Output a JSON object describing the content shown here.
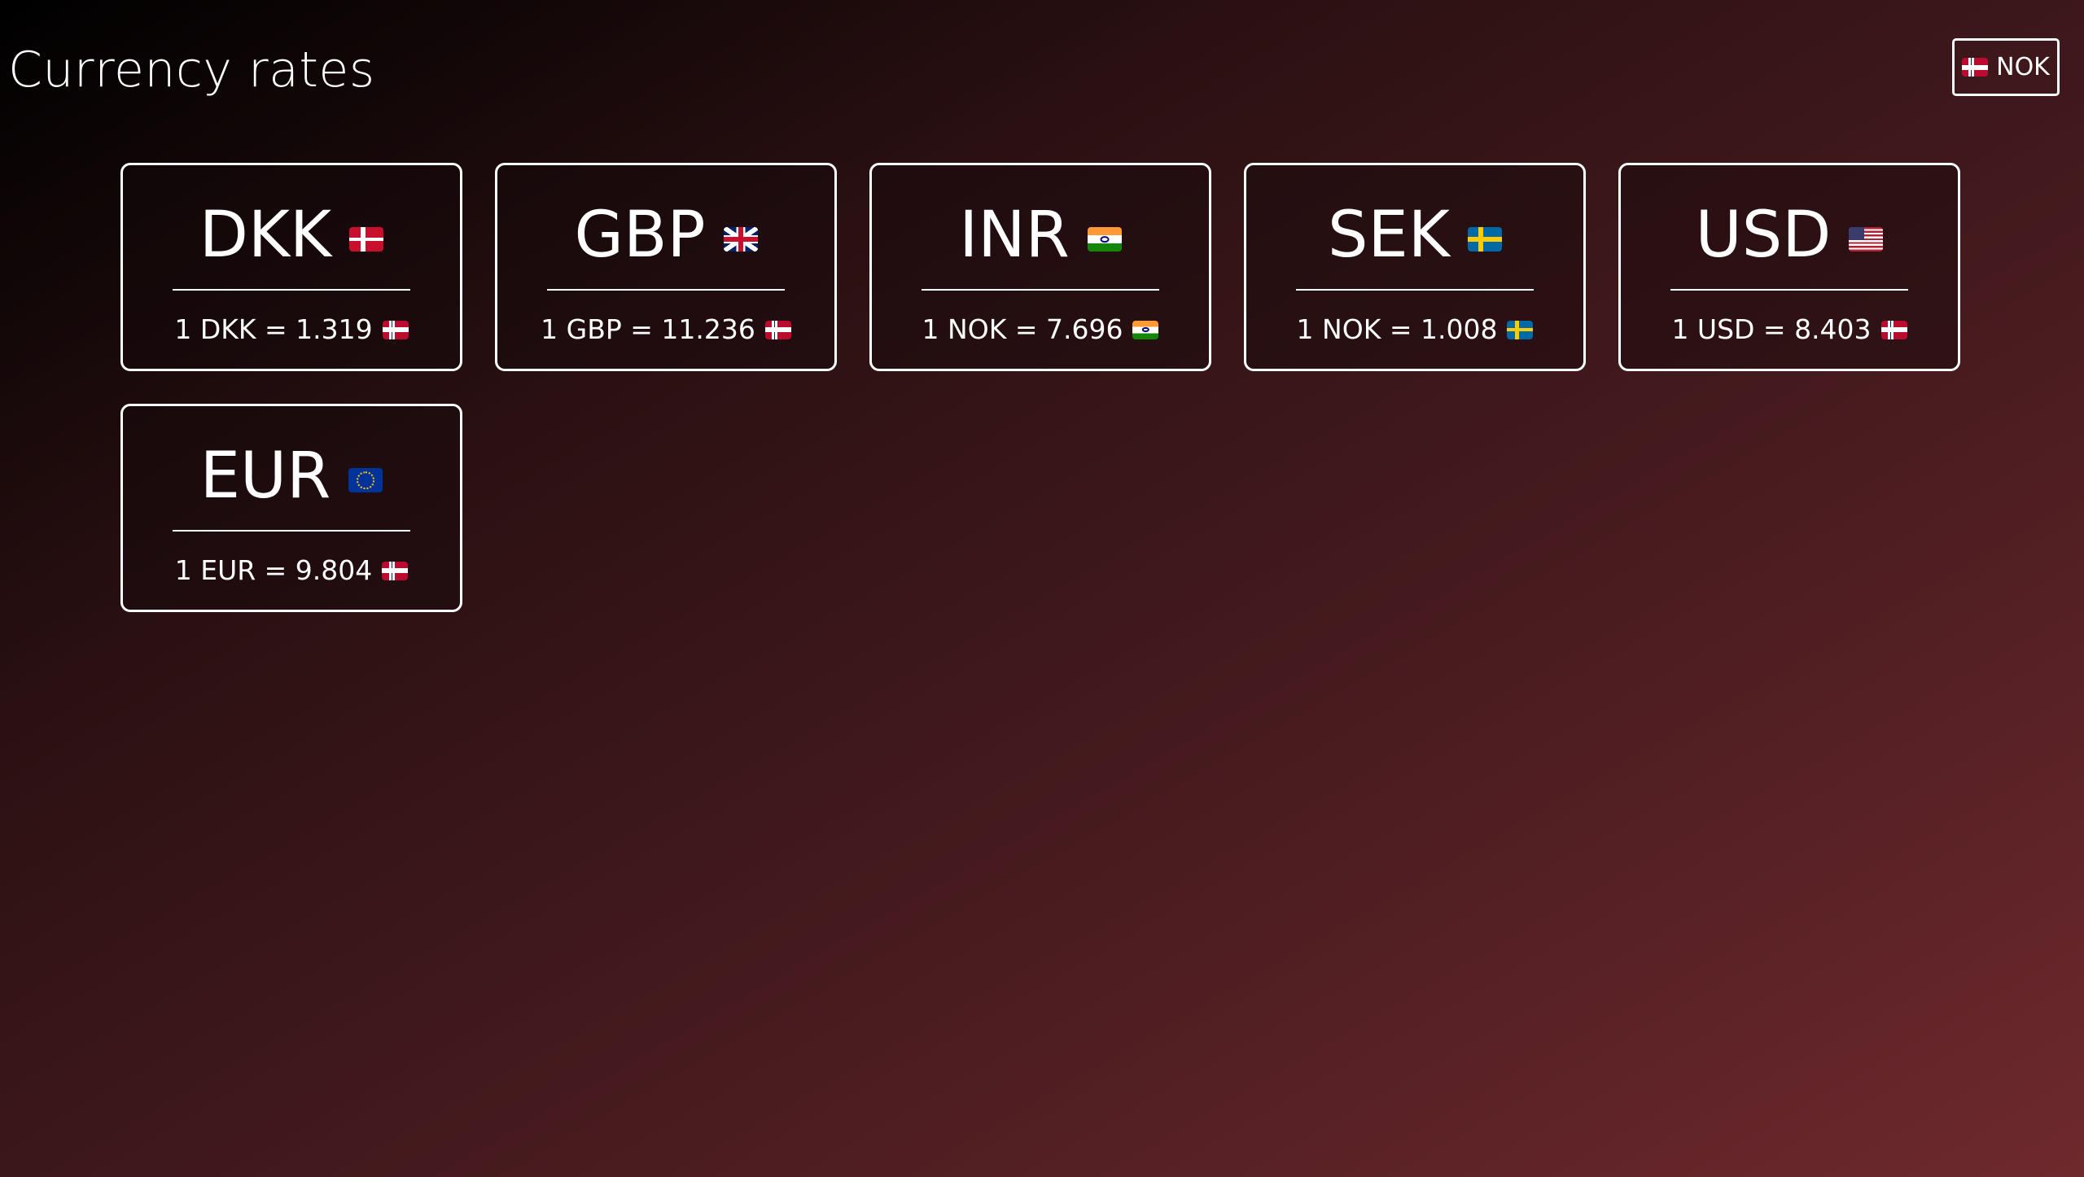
{
  "header": {
    "title": "Currency rates",
    "base_currency": {
      "code": "NOK",
      "flag_icon": "norway-flag-icon"
    }
  },
  "cards": [
    {
      "code": "DKK",
      "flag_icon": "denmark-flag-icon",
      "rate_text": "1 DKK = 1.319",
      "rate_flag_icon": "norway-flag-icon"
    },
    {
      "code": "GBP",
      "flag_icon": "united-kingdom-flag-icon",
      "rate_text": "1 GBP = 11.236",
      "rate_flag_icon": "norway-flag-icon"
    },
    {
      "code": "INR",
      "flag_icon": "india-flag-icon",
      "rate_text": "1 NOK = 7.696",
      "rate_flag_icon": "india-flag-icon"
    },
    {
      "code": "SEK",
      "flag_icon": "sweden-flag-icon",
      "rate_text": "1 NOK = 1.008",
      "rate_flag_icon": "sweden-flag-icon"
    },
    {
      "code": "USD",
      "flag_icon": "united-states-flag-icon",
      "rate_text": "1 USD = 8.403",
      "rate_flag_icon": "norway-flag-icon"
    },
    {
      "code": "EUR",
      "flag_icon": "european-union-flag-icon",
      "rate_text": "1 EUR = 9.804",
      "rate_flag_icon": "norway-flag-icon"
    }
  ],
  "colors": {
    "background_start": "#000000",
    "background_end": "#6e292d",
    "foreground": "#ffffff"
  }
}
